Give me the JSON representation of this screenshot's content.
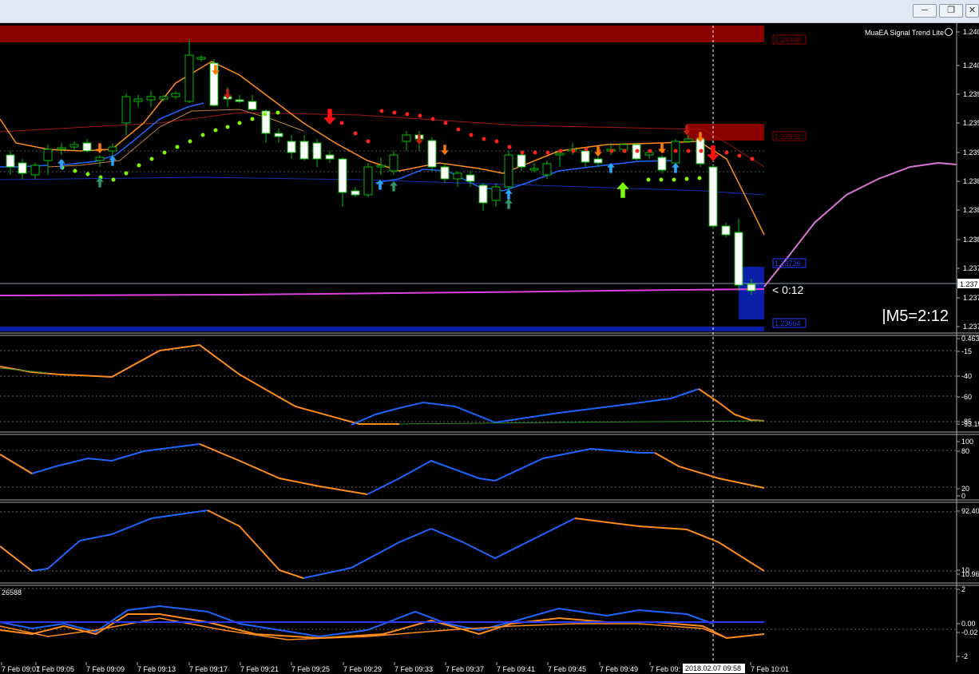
{
  "window": {
    "minimize_icon": "minimize-icon",
    "restore_icon": "restore-icon",
    "close_icon": "close-icon"
  },
  "indicator_label": "MuaEA Signal Trend Lite",
  "main_panel": {
    "price_labels": [
      "1.240",
      "1.240",
      "1.239",
      "1.239",
      "1.239",
      "1.238",
      "1.238",
      "1.238",
      "1.237",
      "1.237",
      "1.237"
    ],
    "current_price_label": "1.237",
    "zone_labels": [
      "1.24048",
      "1.23932",
      "1.23726",
      "1.23664"
    ],
    "candle_countdown": "< 0:12",
    "timeframe_timer": "|M5=2:12"
  },
  "subpanel_1": {
    "scale_labels": [
      "0.463",
      "-15",
      "-40",
      "-60",
      "-85",
      "-93.15"
    ]
  },
  "subpanel_2": {
    "scale_labels": [
      "100",
      "80",
      "20",
      "0"
    ]
  },
  "subpanel_3": {
    "scale_labels": [
      "92.40",
      "10",
      "10.960"
    ]
  },
  "subpanel_4": {
    "title": "26588",
    "scale_labels": [
      "2",
      "0.00",
      "-0.02",
      "-2"
    ]
  },
  "time_axis": {
    "labels": [
      "7 Feb 09:01",
      "7 Feb 09:05",
      "7 Feb 09:09",
      "7 Feb 09:13",
      "7 Feb 09:17",
      "7 Feb 09:21",
      "7 Feb 09:25",
      "7 Feb 09:29",
      "7 Feb 09:33",
      "7 Feb 09:37",
      "7 Feb 09:41",
      "7 Feb 09:45",
      "7 Feb 09:49",
      "7 Feb 09:",
      "7 Feb 10:01"
    ],
    "crosshair_label": "2018.02.07 09:58"
  },
  "colors": {
    "background": "#000000",
    "resistance_zone": "#8b0000",
    "support_zone": "#0a1fa8",
    "ma_fast": "#ff8c1a",
    "ma_blue": "#1e64ff",
    "signal_line": "#e040e0",
    "forecast_line": "#d874d8",
    "dots_green": "#7cfc00",
    "dots_red": "#ff2020",
    "up_arrow": "#2aa8ff",
    "down_arrow": "#ff7a00"
  }
}
